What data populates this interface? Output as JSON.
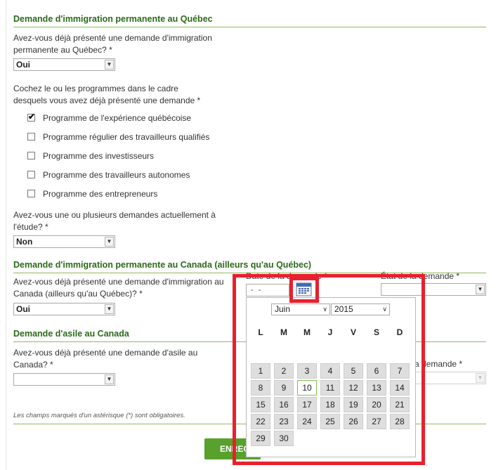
{
  "section1": {
    "title": "Demande d'immigration permanente au Québec",
    "q1_line1": "Avez-vous déjà présenté une demande d'immigration",
    "q1_line2": "permanente au Québec? *",
    "q1_value": "Oui",
    "q2_line1": "Cochez le ou les programmes dans le cadre",
    "q2_line2": "desquels vous avez déjà présenté une demande *",
    "programs": [
      {
        "label": "Programme de l'expérience québécoise",
        "checked": true
      },
      {
        "label": "Programme régulier des travailleurs qualifiés",
        "checked": false
      },
      {
        "label": "Programme des investisseurs",
        "checked": false
      },
      {
        "label": "Programme des travailleurs autonomes",
        "checked": false
      },
      {
        "label": "Programme des entrepreneurs",
        "checked": false
      }
    ],
    "q3_line1": "Avez-vous une ou plusieurs demandes actuellement à",
    "q3_line2": "l'étude? *",
    "q3_value": "Non"
  },
  "section2": {
    "title": "Demande d'immigration permanente au Canada (ailleurs qu'au Québec)",
    "q1_line1": "Avez-vous déjà présenté une demande d'immigration au",
    "q1_line2": "Canada (ailleurs qu'au Québec)? *",
    "q1_value": "Oui",
    "date_label": "Date de la demande *",
    "date_value": "- -",
    "status_label": "État de la demande *",
    "status_value": ""
  },
  "section3": {
    "title": "Demande d'asile au Canada",
    "q1_line1": "Avez-vous déjà présenté une demande d'asile au",
    "q1_line2": "Canada? *",
    "q1_value": "",
    "status_label_partial": "a demande *"
  },
  "footer": {
    "required_note": "Les champs marqués d'un astérisque (*) sont obligatoires.",
    "save_button": "ENREG"
  },
  "calendar": {
    "month": "Juin",
    "year": "2015",
    "weekdays": [
      "L",
      "M",
      "M",
      "J",
      "V",
      "S",
      "D"
    ],
    "weeks": [
      [
        "1",
        "2",
        "3",
        "4",
        "5",
        "6",
        "7"
      ],
      [
        "8",
        "9",
        "10",
        "11",
        "12",
        "13",
        "14"
      ],
      [
        "15",
        "16",
        "17",
        "18",
        "19",
        "20",
        "21"
      ],
      [
        "22",
        "23",
        "24",
        "25",
        "26",
        "27",
        "28"
      ],
      [
        "29",
        "30"
      ]
    ],
    "today": "10"
  },
  "icons": {
    "calendar": "calendar-icon",
    "dropdown": "chevron-down-icon",
    "check": "check-icon"
  },
  "colors": {
    "section_title": "#2a6a1a",
    "section_rule": "#8cbc5a",
    "button": "#57a12c",
    "highlight": "#e8202e",
    "today_border": "#7bbf4a"
  }
}
